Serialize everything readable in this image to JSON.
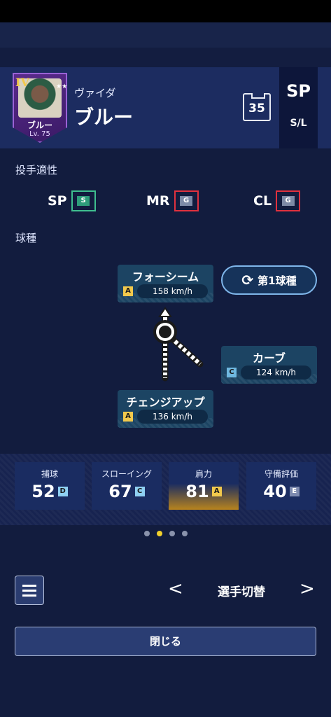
{
  "header": {
    "card": {
      "rank": "IV",
      "name": "ブルー",
      "level": "Lv. 75",
      "stars": "★★★★★"
    },
    "player_sub": "ヴァイダ",
    "player_name": "ブルー",
    "uniform_number": "35",
    "position": "SP",
    "bats_throws": "S/L"
  },
  "aptitude": {
    "title": "投手適性",
    "items": [
      {
        "label": "SP",
        "grade": "S"
      },
      {
        "label": "MR",
        "grade": "G"
      },
      {
        "label": "CL",
        "grade": "G"
      }
    ]
  },
  "pitches": {
    "title": "球種",
    "first_pitch_label": "第1球種",
    "items": [
      {
        "name": "フォーシーム",
        "grade": "A",
        "speed": "158 km/h"
      },
      {
        "name": "カーブ",
        "grade": "C",
        "speed": "124 km/h"
      },
      {
        "name": "チェンジアップ",
        "grade": "A",
        "speed": "136 km/h"
      }
    ]
  },
  "stats": [
    {
      "label": "捕球",
      "value": "52",
      "grade": "D"
    },
    {
      "label": "スローイング",
      "value": "67",
      "grade": "C"
    },
    {
      "label": "肩力",
      "value": "81",
      "grade": "A"
    },
    {
      "label": "守備評価",
      "value": "40",
      "grade": "E"
    }
  ],
  "pager": {
    "count": 4,
    "active_index": 1
  },
  "footer": {
    "prev": "<",
    "switch_label": "選手切替",
    "next": ">",
    "close_label": "閉じる"
  },
  "colors": {
    "background": "#121c3e",
    "accent_gold": "#f2c94c",
    "grade_s": "#2e9c7a",
    "grade_g_border": "#e0313e"
  }
}
